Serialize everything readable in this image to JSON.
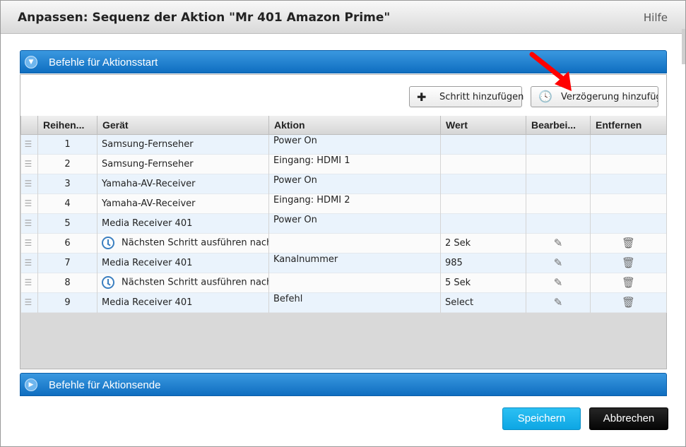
{
  "dialog": {
    "title": "Anpassen: Sequenz der Aktion \"Mr 401 Amazon Prime\"",
    "help": "Hilfe"
  },
  "sections": {
    "start_label": "Befehle für Aktionsstart",
    "end_label": "Befehle für Aktionsende"
  },
  "toolbar": {
    "add_step_label": "Schritt hinzufügen",
    "add_delay_label": "Verzögerung hinzufüg"
  },
  "table": {
    "headers": [
      "Reihen...",
      "Gerät",
      "Aktion",
      "Wert",
      "Bearbei...",
      "Entfernen"
    ],
    "rows": [
      {
        "order": "1",
        "device": "Samsung-Fernseher",
        "action": "Power On",
        "value": "",
        "delay": false,
        "editable": false
      },
      {
        "order": "2",
        "device": "Samsung-Fernseher",
        "action": "Eingang: HDMI 1",
        "value": "",
        "delay": false,
        "editable": false
      },
      {
        "order": "3",
        "device": "Yamaha-AV-Receiver",
        "action": "Power On",
        "value": "",
        "delay": false,
        "editable": false
      },
      {
        "order": "4",
        "device": "Yamaha-AV-Receiver",
        "action": "Eingang: HDMI 2",
        "value": "",
        "delay": false,
        "editable": false
      },
      {
        "order": "5",
        "device": "Media Receiver 401",
        "action": "Power On",
        "value": "",
        "delay": false,
        "editable": false
      },
      {
        "order": "6",
        "device": "Nächsten Schritt ausführen nach",
        "action": "",
        "value": "2 Sek",
        "delay": true,
        "editable": true
      },
      {
        "order": "7",
        "device": "Media Receiver 401",
        "action": "Kanalnummer",
        "value": "985",
        "delay": false,
        "editable": true
      },
      {
        "order": "8",
        "device": "Nächsten Schritt ausführen nach",
        "action": "",
        "value": "5 Sek",
        "delay": true,
        "editable": true
      },
      {
        "order": "9",
        "device": "Media Receiver 401",
        "action": "Befehl",
        "value": "Select",
        "delay": false,
        "editable": true
      }
    ]
  },
  "footer": {
    "save_label": "Speichern",
    "cancel_label": "Abbrechen"
  },
  "colors": {
    "section_blue": "#1a7dd0",
    "save_cyan": "#19b3ec",
    "cancel_black": "#111111",
    "annotation_arrow": "#ff0000"
  },
  "icons": {
    "add": "plus-icon",
    "delay": "clock-icon",
    "edit": "pencil-icon",
    "remove": "trash-icon",
    "drag": "drag-handle-icon"
  }
}
